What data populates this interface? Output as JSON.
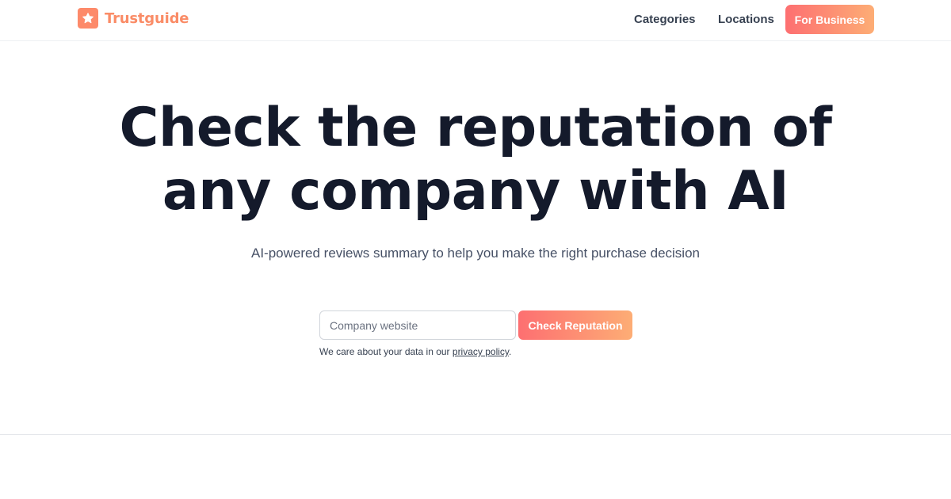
{
  "header": {
    "brand": "Trustguide",
    "brand_icon": "star-icon",
    "nav": {
      "categories": "Categories",
      "locations": "Locations",
      "business_button": "For Business"
    }
  },
  "hero": {
    "title_line1": "Check the reputation of",
    "title_line2": "any company with AI",
    "subtitle": "AI-powered reviews summary to help you make the right purchase decision"
  },
  "search": {
    "placeholder": "Company website",
    "value": "",
    "submit_label": "Check Reputation",
    "privacy_prefix": "We care about your data in our ",
    "privacy_link": "privacy policy",
    "privacy_suffix": "."
  },
  "colors": {
    "brand": "#fa8c67",
    "gradient_start": "#fd6f71",
    "gradient_end": "#fdad75",
    "heading": "#141a2b"
  }
}
